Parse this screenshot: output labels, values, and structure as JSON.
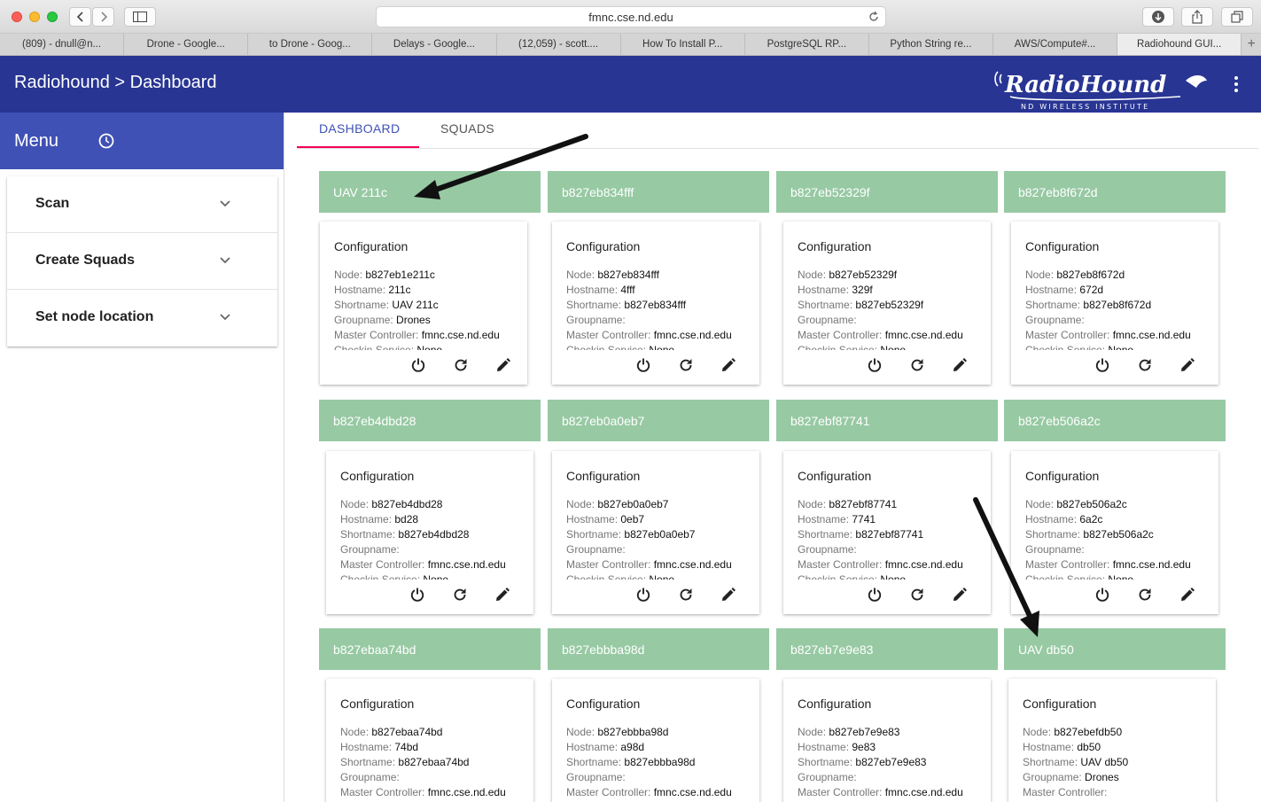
{
  "browser": {
    "url": "fmnc.cse.nd.edu",
    "tabs": [
      {
        "label": "(809) - dnull@n...",
        "active": false
      },
      {
        "label": "Drone - Google...",
        "active": false
      },
      {
        "label": "to Drone - Goog...",
        "active": false
      },
      {
        "label": "Delays - Google...",
        "active": false
      },
      {
        "label": "(12,059) - scott....",
        "active": false
      },
      {
        "label": "How To Install P...",
        "active": false
      },
      {
        "label": "PostgreSQL RP...",
        "active": false
      },
      {
        "label": "Python String re...",
        "active": false
      },
      {
        "label": "AWS/Compute#...",
        "active": false
      },
      {
        "label": "Radiohound GUI...",
        "active": true
      }
    ],
    "new_tab_symbol": "+"
  },
  "header": {
    "title": "Radiohound > Dashboard",
    "logo_text": "RadioHound",
    "logo_subtext": "ND WIRELESS INSTITUTE",
    "colors": {
      "appbar": "#283593",
      "menu": "#3f51b5",
      "accent": "#f50057",
      "node_bar": "#97c9a3"
    }
  },
  "sidebar": {
    "menu_label": "Menu",
    "panels": [
      {
        "label": "Scan"
      },
      {
        "label": "Create Squads"
      },
      {
        "label": "Set node location"
      }
    ]
  },
  "main": {
    "tabs": [
      {
        "label": "DASHBOARD",
        "active": true
      },
      {
        "label": "SQUADS",
        "active": false
      }
    ],
    "field_labels": {
      "node": "Node:",
      "hostname": "Hostname:",
      "shortname": "Shortname:",
      "groupname": "Groupname:",
      "master": "Master Controller:",
      "checkin": "Checkin Service:"
    },
    "card_title": "Configuration",
    "nodes": [
      {
        "bar": "UAV 211c",
        "node": "b827eb1e211c",
        "hostname": "211c",
        "shortname": "UAV 211c",
        "groupname": "Drones",
        "master": "fmnc.cse.nd.edu",
        "checkin": "None"
      },
      {
        "bar": "b827eb834fff",
        "node": "b827eb834fff",
        "hostname": "4fff",
        "shortname": "b827eb834fff",
        "groupname": "",
        "master": "fmnc.cse.nd.edu",
        "checkin": "None"
      },
      {
        "bar": "b827eb52329f",
        "node": "b827eb52329f",
        "hostname": "329f",
        "shortname": "b827eb52329f",
        "groupname": "",
        "master": "fmnc.cse.nd.edu",
        "checkin": "None"
      },
      {
        "bar": "b827eb8f672d",
        "node": "b827eb8f672d",
        "hostname": "672d",
        "shortname": "b827eb8f672d",
        "groupname": "",
        "master": "fmnc.cse.nd.edu",
        "checkin": "None"
      },
      {
        "bar": "b827eb4dbd28",
        "node": "b827eb4dbd28",
        "hostname": "bd28",
        "shortname": "b827eb4dbd28",
        "groupname": "",
        "master": "fmnc.cse.nd.edu",
        "checkin": "None"
      },
      {
        "bar": "b827eb0a0eb7",
        "node": "b827eb0a0eb7",
        "hostname": "0eb7",
        "shortname": "b827eb0a0eb7",
        "groupname": "",
        "master": "fmnc.cse.nd.edu",
        "checkin": "None"
      },
      {
        "bar": "b827ebf87741",
        "node": "b827ebf87741",
        "hostname": "7741",
        "shortname": "b827ebf87741",
        "groupname": "",
        "master": "fmnc.cse.nd.edu",
        "checkin": "None"
      },
      {
        "bar": "b827eb506a2c",
        "node": "b827eb506a2c",
        "hostname": "6a2c",
        "shortname": "b827eb506a2c",
        "groupname": "",
        "master": "fmnc.cse.nd.edu",
        "checkin": "None"
      },
      {
        "bar": "b827ebaa74bd",
        "node": "b827ebaa74bd",
        "hostname": "74bd",
        "shortname": "b827ebaa74bd",
        "groupname": "",
        "master": "fmnc.cse.nd.edu",
        "checkin": ""
      },
      {
        "bar": "b827ebbba98d",
        "node": "b827ebbba98d",
        "hostname": "a98d",
        "shortname": "b827ebbba98d",
        "groupname": "",
        "master": "fmnc.cse.nd.edu",
        "checkin": ""
      },
      {
        "bar": "b827eb7e9e83",
        "node": "b827eb7e9e83",
        "hostname": "9e83",
        "shortname": "b827eb7e9e83",
        "groupname": "",
        "master": "fmnc.cse.nd.edu",
        "checkin": ""
      },
      {
        "bar": "UAV db50",
        "node": "b827ebefdb50",
        "hostname": "db50",
        "shortname": "UAV db50",
        "groupname": "Drones",
        "master": "",
        "checkin": ""
      }
    ],
    "card_actions": [
      {
        "icon": "power-icon"
      },
      {
        "icon": "refresh-icon"
      },
      {
        "icon": "edit-pencil-icon"
      }
    ]
  }
}
